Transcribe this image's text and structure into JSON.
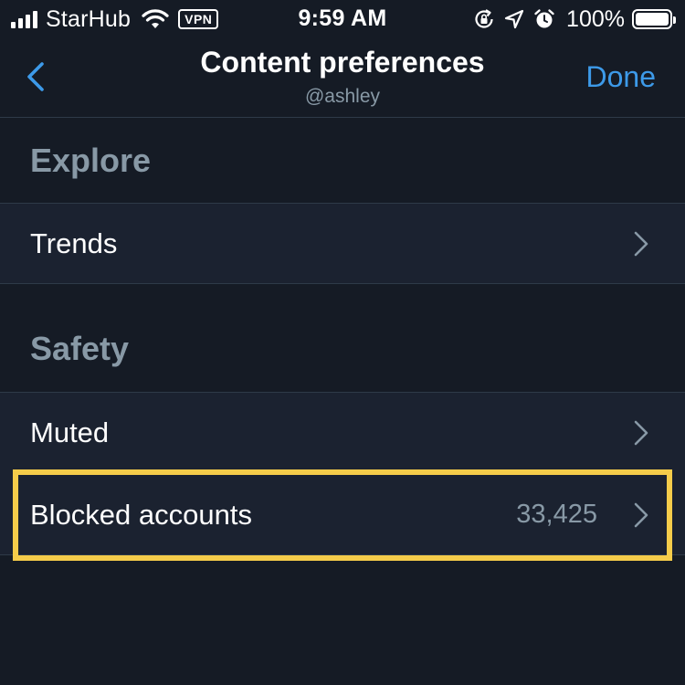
{
  "status_bar": {
    "carrier": "StarHub",
    "vpn": "VPN",
    "time": "9:59 AM",
    "battery": "100%",
    "icons": [
      "signal-icon",
      "wifi-icon",
      "orientation-lock-icon",
      "location-icon",
      "alarm-icon",
      "battery-icon"
    ]
  },
  "nav": {
    "back_icon": "chevron-left-icon",
    "title": "Content preferences",
    "subtitle": "@ashley",
    "done": "Done"
  },
  "sections": [
    {
      "header": "Explore",
      "rows": [
        {
          "label": "Trends",
          "value": ""
        }
      ]
    },
    {
      "header": "Safety",
      "rows": [
        {
          "label": "Muted",
          "value": ""
        },
        {
          "label": "Blocked accounts",
          "value": "33,425"
        }
      ]
    }
  ],
  "colors": {
    "background": "#151b25",
    "row_background": "#1b2230",
    "accent": "#3d9ae9",
    "secondary_text": "#8899a6",
    "highlight": "#f5cc4a"
  }
}
